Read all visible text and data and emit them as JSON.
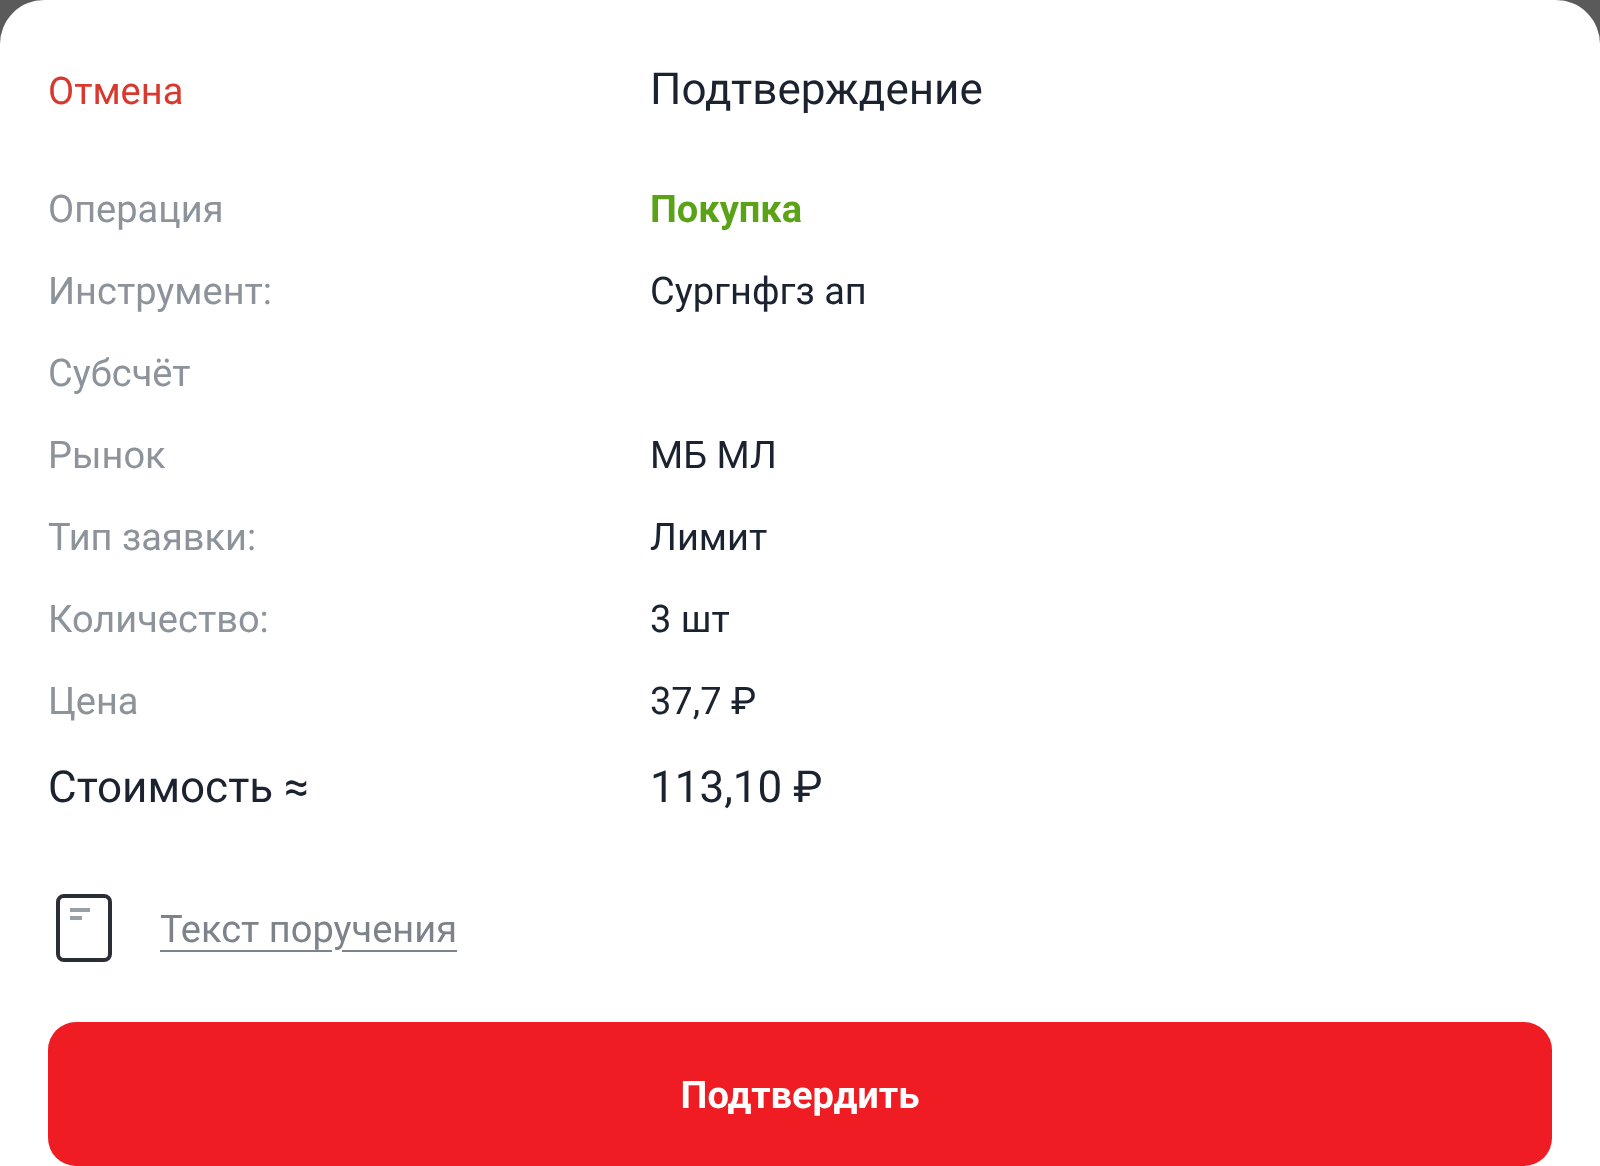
{
  "header": {
    "cancel": "Отмена",
    "title": "Подтверждение"
  },
  "rows": [
    {
      "kind": "accent",
      "label": "Операция",
      "value": "Покупка"
    },
    {
      "kind": "plain",
      "label": "Инструмент:",
      "value": "Сургнфгз ап"
    },
    {
      "kind": "plain",
      "label": "Субсчёт"
    },
    {
      "kind": "plain",
      "label": "Рынок",
      "value": "МБ МЛ"
    },
    {
      "kind": "plain",
      "label": "Тип заявки:",
      "value": "Лимит"
    },
    {
      "kind": "plain",
      "label": "Количество:",
      "value": "3 шт"
    },
    {
      "kind": "plain",
      "label": "Цена",
      "value": "37,7 ₽"
    },
    {
      "kind": "total",
      "label": "Стоимость ≈",
      "value": "113,10 ₽"
    }
  ],
  "order_text_link": "Текст поручения",
  "confirm_button": "Подтвердить"
}
